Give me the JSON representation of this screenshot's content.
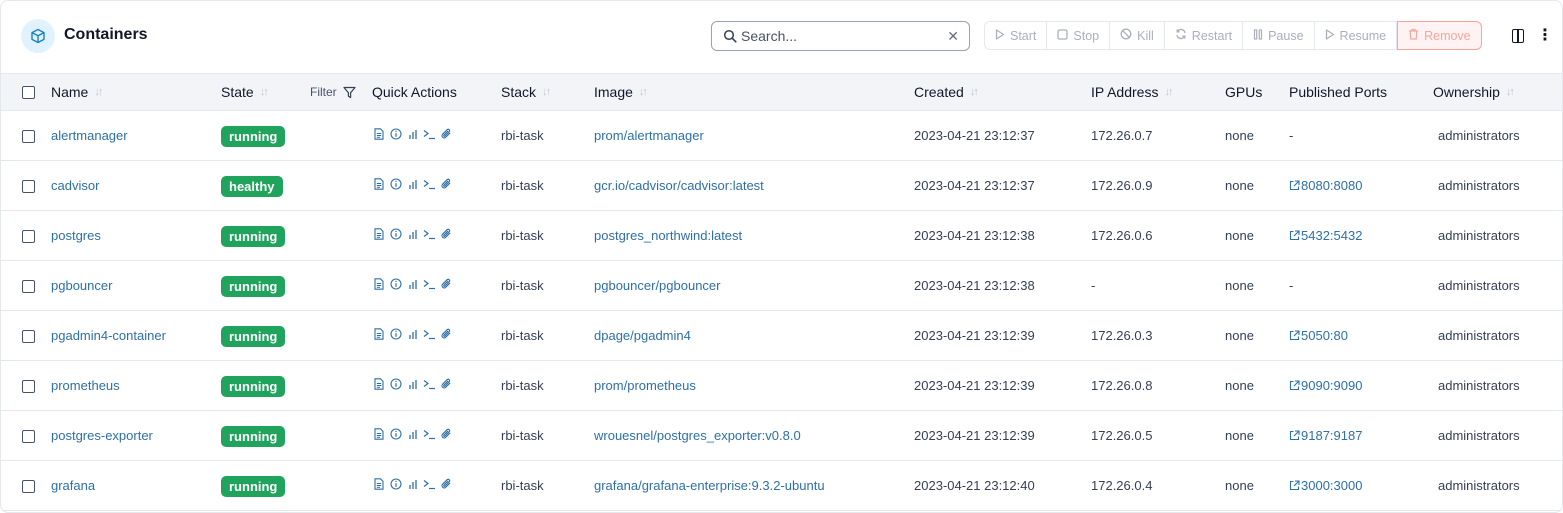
{
  "header": {
    "title": "Containers",
    "search_placeholder": "Search...",
    "actions": {
      "start": "Start",
      "stop": "Stop",
      "kill": "Kill",
      "restart": "Restart",
      "pause": "Pause",
      "resume": "Resume",
      "remove": "Remove"
    }
  },
  "colors": {
    "accent": "#2e6fa7",
    "badge": "#20a35c",
    "remove_bg": "#fef3f2"
  },
  "table": {
    "columns": {
      "name": "Name",
      "state": "State",
      "filter": "Filter",
      "quick_actions": "Quick Actions",
      "stack": "Stack",
      "image": "Image",
      "created": "Created",
      "ip": "IP Address",
      "gpus": "GPUs",
      "ports": "Published Ports",
      "ownership": "Ownership"
    },
    "rows": [
      {
        "name": "alertmanager",
        "state": "running",
        "stack": "rbi-task",
        "image": "prom/alertmanager",
        "created": "2023-04-21 23:12:37",
        "ip": "172.26.0.7",
        "gpus": "none",
        "ports": "-",
        "ownership": "administrators"
      },
      {
        "name": "cadvisor",
        "state": "healthy",
        "stack": "rbi-task",
        "image": "gcr.io/cadvisor/cadvisor:latest",
        "created": "2023-04-21 23:12:37",
        "ip": "172.26.0.9",
        "gpus": "none",
        "ports": "8080:8080",
        "ownership": "administrators"
      },
      {
        "name": "postgres",
        "state": "running",
        "stack": "rbi-task",
        "image": "postgres_northwind:latest",
        "created": "2023-04-21 23:12:38",
        "ip": "172.26.0.6",
        "gpus": "none",
        "ports": "5432:5432",
        "ownership": "administrators"
      },
      {
        "name": "pgbouncer",
        "state": "running",
        "stack": "rbi-task",
        "image": "pgbouncer/pgbouncer",
        "created": "2023-04-21 23:12:38",
        "ip": "-",
        "gpus": "none",
        "ports": "-",
        "ownership": "administrators"
      },
      {
        "name": "pgadmin4-container",
        "state": "running",
        "stack": "rbi-task",
        "image": "dpage/pgadmin4",
        "created": "2023-04-21 23:12:39",
        "ip": "172.26.0.3",
        "gpus": "none",
        "ports": "5050:80",
        "ownership": "administrators"
      },
      {
        "name": "prometheus",
        "state": "running",
        "stack": "rbi-task",
        "image": "prom/prometheus",
        "created": "2023-04-21 23:12:39",
        "ip": "172.26.0.8",
        "gpus": "none",
        "ports": "9090:9090",
        "ownership": "administrators"
      },
      {
        "name": "postgres-exporter",
        "state": "running",
        "stack": "rbi-task",
        "image": "wrouesnel/postgres_exporter:v0.8.0",
        "created": "2023-04-21 23:12:39",
        "ip": "172.26.0.5",
        "gpus": "none",
        "ports": "9187:9187",
        "ownership": "administrators"
      },
      {
        "name": "grafana",
        "state": "running",
        "stack": "rbi-task",
        "image": "grafana/grafana-enterprise:9.3.2-ubuntu",
        "created": "2023-04-21 23:12:40",
        "ip": "172.26.0.4",
        "gpus": "none",
        "ports": "3000:3000",
        "ownership": "administrators"
      }
    ]
  }
}
